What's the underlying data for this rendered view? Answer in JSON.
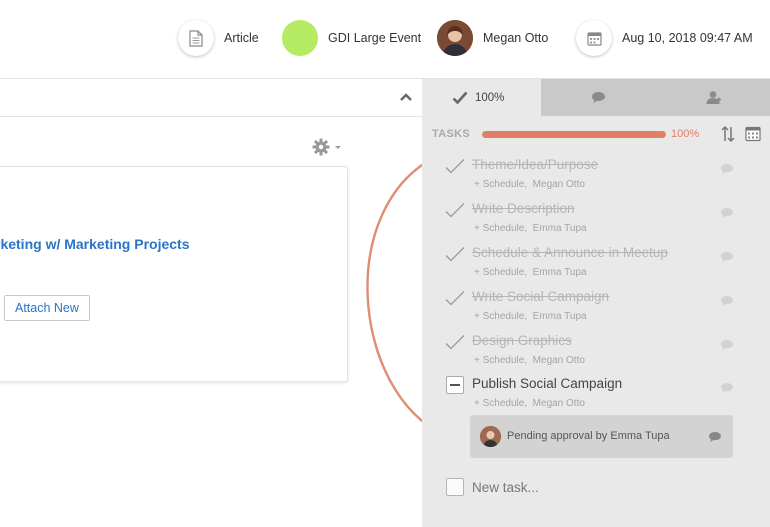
{
  "header": {
    "type_label": "Article",
    "event_label": "GDI Large Event",
    "user_name": "Megan Otto",
    "datetime": "Aug 10, 2018 09:47 AM"
  },
  "main": {
    "card_title": "rketing w/ Marketing Projects",
    "attach_label": "Attach New"
  },
  "panel": {
    "tabs": [
      {
        "label": "100%",
        "icon": "check-icon"
      },
      {
        "label": "",
        "icon": "comment-icon"
      },
      {
        "label": "",
        "icon": "people-icon"
      }
    ],
    "tasks_label": "TASKS",
    "progress": 100,
    "progress_label": "100%",
    "tasks": [
      {
        "title": "Theme/Idea/Purpose",
        "schedule": "+ Schedule,",
        "assignee": "Megan Otto",
        "done": true
      },
      {
        "title": "Write Description",
        "schedule": "+ Schedule,",
        "assignee": "Emma Tupa",
        "done": true
      },
      {
        "title": "Schedule & Announce in Meetup",
        "schedule": "+ Schedule,",
        "assignee": "Emma Tupa",
        "done": true
      },
      {
        "title": "Write Social Campaign",
        "schedule": "+ Schedule,",
        "assignee": "Emma Tupa",
        "done": true
      },
      {
        "title": "Design Graphics",
        "schedule": "+ Schedule,",
        "assignee": "Megan Otto",
        "done": true
      },
      {
        "title": "Publish Social Campaign",
        "schedule": "+ Schedule,",
        "assignee": "Megan Otto",
        "done": false
      }
    ],
    "approval_text": "Pending approval by Emma Tupa",
    "new_task_placeholder": "New task..."
  },
  "colors": {
    "accent": "#e07e67",
    "link": "#2b74c7",
    "event_dot": "#b5ea63"
  }
}
